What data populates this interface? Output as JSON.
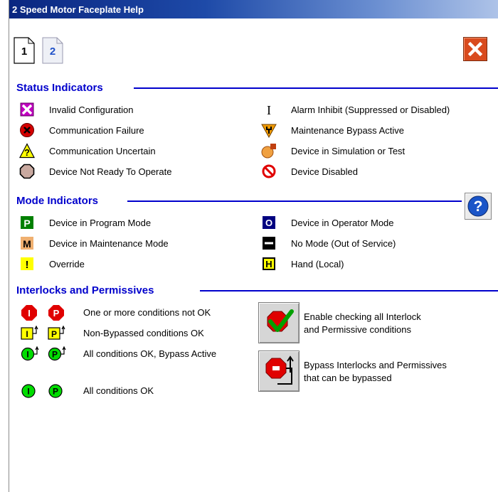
{
  "window": {
    "title": "2 Speed Motor Faceplate Help"
  },
  "pages": [
    {
      "label": "1"
    },
    {
      "label": "2"
    }
  ],
  "status": {
    "title": "Status Indicators",
    "left": [
      {
        "icon": "invalid-configuration-icon",
        "label": "Invalid Configuration"
      },
      {
        "icon": "communication-failure-icon",
        "label": "Communication Failure"
      },
      {
        "icon": "communication-uncertain-icon",
        "label": "Communication Uncertain"
      },
      {
        "icon": "device-not-ready-icon",
        "label": "Device Not Ready To Operate"
      }
    ],
    "right": [
      {
        "icon": "alarm-inhibit-icon",
        "label": "Alarm Inhibit (Suppressed or Disabled)"
      },
      {
        "icon": "maintenance-bypass-icon",
        "label": "Maintenance Bypass Active"
      },
      {
        "icon": "simulation-icon",
        "label": "Device in Simulation or Test"
      },
      {
        "icon": "device-disabled-icon",
        "label": "Device Disabled"
      }
    ]
  },
  "mode": {
    "title": "Mode Indicators",
    "left": [
      {
        "icon": "program-mode-icon",
        "letter": "P",
        "label": "Device in Program Mode"
      },
      {
        "icon": "maintenance-mode-icon",
        "letter": "M",
        "label": "Device in Maintenance Mode"
      },
      {
        "icon": "override-icon",
        "letter": "!",
        "label": "Override"
      }
    ],
    "right": [
      {
        "icon": "operator-mode-icon",
        "letter": "O",
        "label": "Device in Operator Mode"
      },
      {
        "icon": "no-mode-icon",
        "letter": "",
        "label": "No Mode (Out of Service)"
      },
      {
        "icon": "hand-local-icon",
        "letter": "H",
        "label": "Hand (Local)"
      }
    ]
  },
  "interlocks": {
    "title": "Interlocks and Permissives",
    "rows": [
      {
        "label": "One or more conditions not OK"
      },
      {
        "label": "Non-Bypassed conditions OK"
      },
      {
        "label": "All conditions OK, Bypass Active"
      },
      {
        "label": "All conditions OK"
      }
    ],
    "letters": {
      "interlock": "I",
      "permissive": "P"
    },
    "actions": [
      {
        "line1": "Enable checking all Interlock",
        "line2": "and Permissive conditions"
      },
      {
        "line1": "Bypass Interlocks and Permissives",
        "line2": "that can be bypassed"
      }
    ]
  },
  "colors": {
    "section": "#0000cc",
    "titlebar": "#0a2680",
    "close": "#d94b1e"
  }
}
